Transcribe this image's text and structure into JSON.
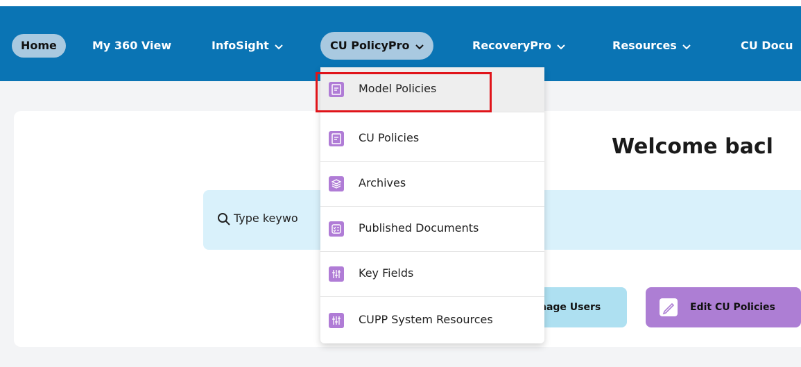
{
  "nav": {
    "items": [
      {
        "label": "Home",
        "has_chevron": false,
        "active": true
      },
      {
        "label": "My 360 View",
        "has_chevron": false
      },
      {
        "label": "InfoSight",
        "has_chevron": true
      },
      {
        "label": "CU PolicyPro",
        "has_chevron": true,
        "open": true
      },
      {
        "label": "RecoveryPro",
        "has_chevron": true
      },
      {
        "label": "Resources",
        "has_chevron": true
      },
      {
        "label": "CU Docu",
        "has_chevron": false
      }
    ],
    "bg_color": "#0a74b4"
  },
  "dropdown": {
    "items": [
      {
        "label": "Model Policies",
        "icon": "document-icon",
        "highlighted": true
      },
      {
        "label": "CU Policies",
        "icon": "document-icon"
      },
      {
        "label": "Archives",
        "icon": "layers-icon"
      },
      {
        "label": "Published Documents",
        "icon": "checklist-icon"
      },
      {
        "label": "Key Fields",
        "icon": "sliders-icon"
      },
      {
        "label": "CUPP System Resources",
        "icon": "sliders-icon"
      }
    ],
    "icon_color": "#b07cd6",
    "highlight_color": "#e0141a"
  },
  "main": {
    "welcome": "Welcome bacl",
    "search_placeholder": "Type keywo",
    "buttons": {
      "manage_users": "nage Users",
      "edit_policies": "Edit CU Policies"
    }
  }
}
